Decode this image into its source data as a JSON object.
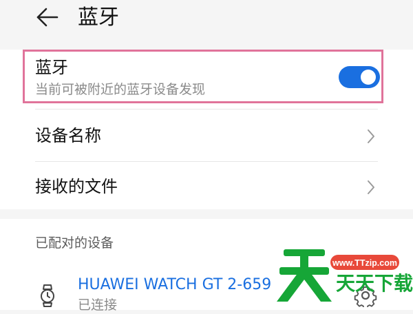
{
  "header": {
    "title": "蓝牙"
  },
  "bluetooth": {
    "title": "蓝牙",
    "subtitle": "当前可被附近的蓝牙设备发现",
    "enabled": true
  },
  "rows": [
    {
      "label": "设备名称"
    },
    {
      "label": "接收的文件"
    }
  ],
  "paired": {
    "section_label": "已配对的设备",
    "devices": [
      {
        "name": "HUAWEI WATCH GT 2-659",
        "status": "已连接"
      }
    ]
  },
  "watermark": {
    "url": "www.TTzip.com",
    "text": "天天下载"
  },
  "colors": {
    "accent": "#1a6fe0",
    "highlight_border": "#e0739a",
    "watermark_green": "#16a637",
    "watermark_badge": "#e8493a"
  },
  "icons": {
    "back": "arrow-left-icon",
    "toggle": "toggle-switch-icon",
    "chevron": "chevron-right-icon",
    "watch": "smartwatch-icon",
    "settings": "gear-icon"
  }
}
